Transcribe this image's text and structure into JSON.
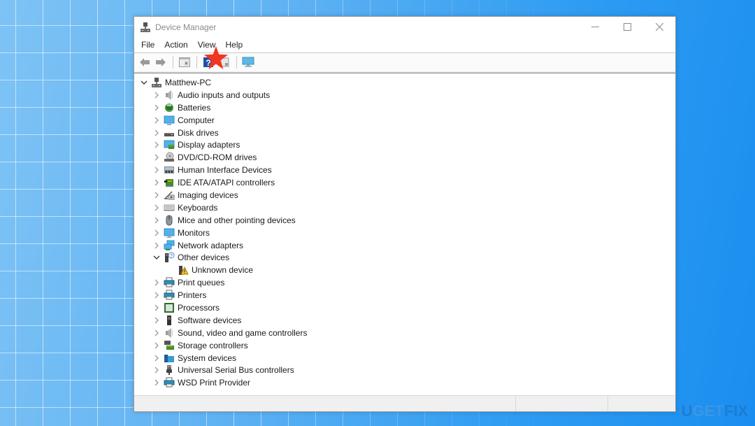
{
  "window": {
    "title": "Device Manager",
    "controls": {
      "minimize": "minimize",
      "maximize": "maximize",
      "close": "close"
    }
  },
  "menu": [
    "File",
    "Action",
    "View",
    "Help"
  ],
  "toolbar": {
    "buttons": [
      {
        "name": "back",
        "icon": "arrow-left-icon"
      },
      {
        "name": "forward",
        "icon": "arrow-right-icon"
      },
      {
        "name": "show-hide-console-tree",
        "icon": "console-tree-icon"
      },
      {
        "name": "help",
        "icon": "help-icon"
      },
      {
        "name": "properties",
        "icon": "properties-icon"
      },
      {
        "name": "scan-for-hardware-changes",
        "icon": "monitor-scan-icon"
      }
    ],
    "annotation": "red-star-marker"
  },
  "tree": {
    "root": {
      "label": "Matthew-PC",
      "expanded": true,
      "icon": "computer-network-icon"
    },
    "items": [
      {
        "label": "Audio inputs and outputs",
        "icon": "speaker-icon",
        "expanded": false
      },
      {
        "label": "Batteries",
        "icon": "battery-icon",
        "expanded": false
      },
      {
        "label": "Computer",
        "icon": "computer-icon",
        "expanded": false
      },
      {
        "label": "Disk drives",
        "icon": "disk-drive-icon",
        "expanded": false
      },
      {
        "label": "Display adapters",
        "icon": "display-adapter-icon",
        "expanded": false
      },
      {
        "label": "DVD/CD-ROM drives",
        "icon": "dvd-drive-icon",
        "expanded": false
      },
      {
        "label": "Human Interface Devices",
        "icon": "hid-icon",
        "expanded": false
      },
      {
        "label": "IDE ATA/ATAPI controllers",
        "icon": "ide-controller-icon",
        "expanded": false
      },
      {
        "label": "Imaging devices",
        "icon": "camera-icon",
        "expanded": false
      },
      {
        "label": "Keyboards",
        "icon": "keyboard-icon",
        "expanded": false
      },
      {
        "label": "Mice and other pointing devices",
        "icon": "mouse-icon",
        "expanded": false
      },
      {
        "label": "Monitors",
        "icon": "monitor-icon",
        "expanded": false
      },
      {
        "label": "Network adapters",
        "icon": "network-adapter-icon",
        "expanded": false
      },
      {
        "label": "Other devices",
        "icon": "unknown-device-category-icon",
        "expanded": true,
        "children": [
          {
            "label": "Unknown device",
            "icon": "warning-device-icon"
          }
        ]
      },
      {
        "label": "Print queues",
        "icon": "printer-icon",
        "expanded": false
      },
      {
        "label": "Printers",
        "icon": "printer-icon",
        "expanded": false
      },
      {
        "label": "Processors",
        "icon": "processor-icon",
        "expanded": false
      },
      {
        "label": "Software devices",
        "icon": "software-device-icon",
        "expanded": false
      },
      {
        "label": "Sound, video and game controllers",
        "icon": "speaker-icon",
        "expanded": false
      },
      {
        "label": "Storage controllers",
        "icon": "storage-controller-icon",
        "expanded": false
      },
      {
        "label": "System devices",
        "icon": "system-folder-icon",
        "expanded": false
      },
      {
        "label": "Universal Serial Bus controllers",
        "icon": "usb-icon",
        "expanded": false
      },
      {
        "label": "WSD Print Provider",
        "icon": "printer-icon",
        "expanded": false
      }
    ]
  },
  "watermark": {
    "left": "U",
    "middle": "GET",
    "right": "FIX"
  },
  "colors": {
    "accent_star": "#f2361f",
    "desktop_blue": "#1a8ef0"
  }
}
